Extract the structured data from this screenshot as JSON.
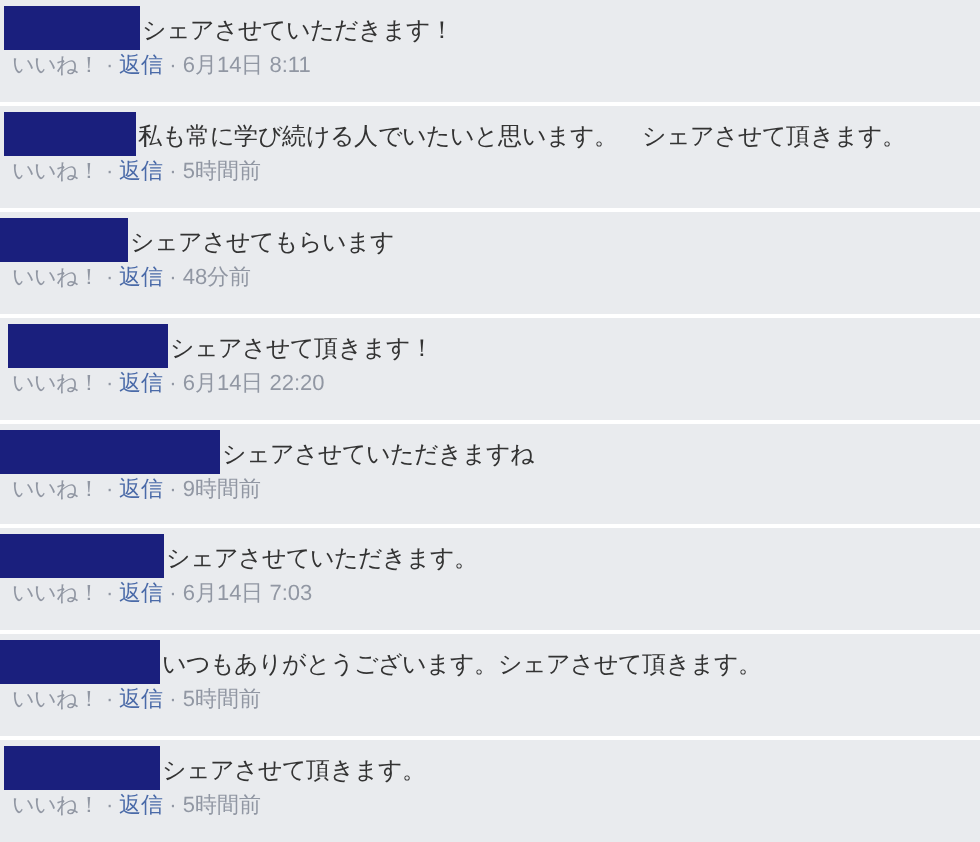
{
  "comments": [
    {
      "text": "シェアさせていただきます！",
      "meta": [
        {
          "kind": "like",
          "text": "いいね！"
        },
        {
          "kind": "dot",
          "text": "·"
        },
        {
          "kind": "reply",
          "text": "返信"
        },
        {
          "kind": "dot",
          "text": "·"
        },
        {
          "kind": "time",
          "text": "6月14日 8:11"
        }
      ]
    },
    {
      "text": "私も常に学び続ける人でいたいと思います。　シェアさせて頂きます。",
      "meta": [
        {
          "kind": "like",
          "text": "いいね！"
        },
        {
          "kind": "dot",
          "text": "·"
        },
        {
          "kind": "reply",
          "text": "返信"
        },
        {
          "kind": "dot",
          "text": "·"
        },
        {
          "kind": "time",
          "text": "5時間前"
        }
      ]
    },
    {
      "text": "シェアさせてもらいます",
      "meta": [
        {
          "kind": "like",
          "text": "いいね！"
        },
        {
          "kind": "dot",
          "text": "·"
        },
        {
          "kind": "reply",
          "text": "返信"
        },
        {
          "kind": "dot",
          "text": "·"
        },
        {
          "kind": "time",
          "text": "48分前"
        }
      ]
    },
    {
      "text": "シェアさせて頂きます！",
      "meta": [
        {
          "kind": "like",
          "text": "いいね！"
        },
        {
          "kind": "dot",
          "text": "·"
        },
        {
          "kind": "reply",
          "text": "返信"
        },
        {
          "kind": "dot",
          "text": "·"
        },
        {
          "kind": "time",
          "text": "6月14日 22:20"
        }
      ]
    },
    {
      "text": "シェアさせていただきますね",
      "meta": [
        {
          "kind": "like",
          "text": "いいね！"
        },
        {
          "kind": "dot",
          "text": "·"
        },
        {
          "kind": "reply",
          "text": "返信"
        },
        {
          "kind": "dot",
          "text": "·"
        },
        {
          "kind": "time",
          "text": "9時間前"
        }
      ]
    },
    {
      "text": "シェアさせていただきます。",
      "meta": [
        {
          "kind": "like",
          "text": "いいね！"
        },
        {
          "kind": "dot",
          "text": "·"
        },
        {
          "kind": "reply",
          "text": "返信"
        },
        {
          "kind": "dot",
          "text": "·"
        },
        {
          "kind": "time",
          "text": "6月14日 7:03"
        }
      ]
    },
    {
      "text": "いつもありがとうございます。シェアさせて頂きます。",
      "meta": [
        {
          "kind": "like",
          "text": "いいね！"
        },
        {
          "kind": "dot",
          "text": "·"
        },
        {
          "kind": "reply",
          "text": "返信"
        },
        {
          "kind": "dot",
          "text": "·"
        },
        {
          "kind": "time",
          "text": "5時間前"
        }
      ]
    },
    {
      "text": "シェアさせて頂きます。",
      "meta": [
        {
          "kind": "like",
          "text": "いいね！"
        },
        {
          "kind": "dot",
          "text": "·"
        },
        {
          "kind": "reply",
          "text": "返信"
        },
        {
          "kind": "dot",
          "text": "·"
        },
        {
          "kind": "time",
          "text": "5時間前"
        }
      ]
    }
  ]
}
